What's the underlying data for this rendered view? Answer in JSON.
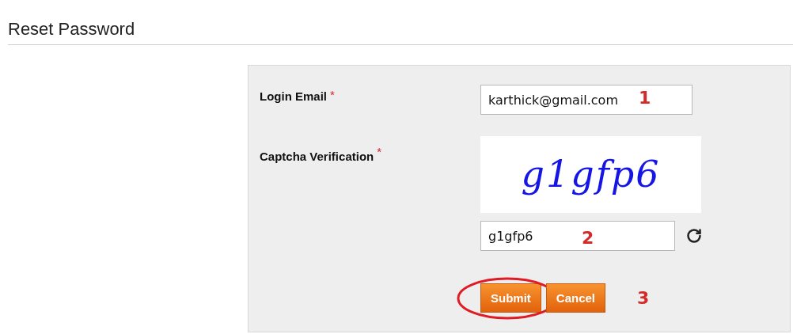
{
  "page": {
    "title": "Reset Password"
  },
  "form": {
    "fields": [
      {
        "kind": "text",
        "label": "Login Email",
        "required_mark": "*",
        "value": "karthick@gmail.com",
        "note": "1"
      },
      {
        "kind": "captcha",
        "label": "Captcha Verification",
        "required_mark": "*",
        "captcha": "g1gfp6",
        "value": "g1gfp6",
        "note": "2"
      }
    ],
    "buttons": [
      {
        "label": "Submit",
        "circled": true
      },
      {
        "label": "Cancel",
        "circled": false
      }
    ],
    "buttons_note": "3"
  }
}
